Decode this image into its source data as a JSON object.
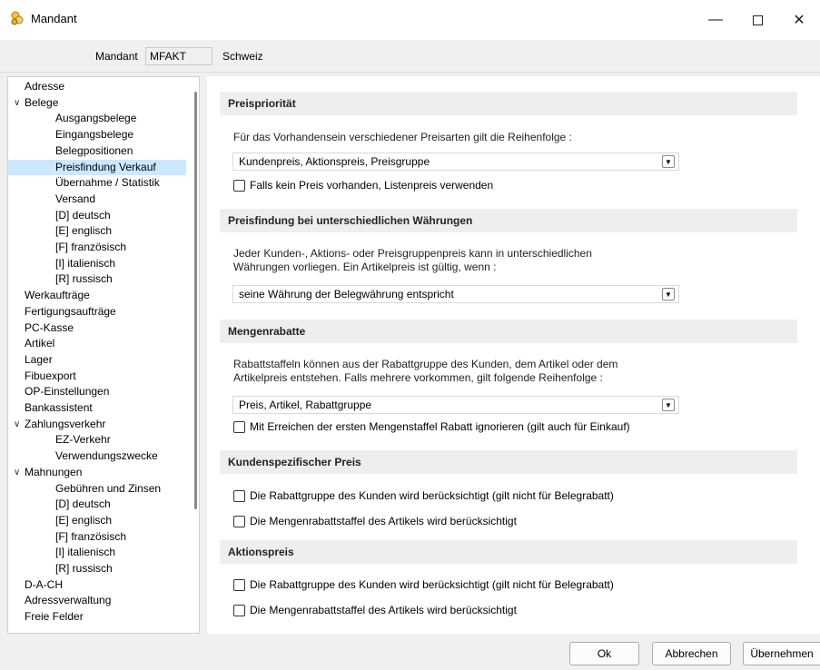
{
  "window": {
    "title": "Mandant",
    "minimize": "—",
    "close": "✕",
    "icon": "mandant-app-icon"
  },
  "header": {
    "mandant_label": "Mandant",
    "mandant_value": "MFAKT",
    "mandant_name": "Schweiz"
  },
  "tree": {
    "items": [
      {
        "label": "Adresse",
        "indent": 0,
        "arrow": ""
      },
      {
        "label": "Belege",
        "indent": 0,
        "arrow": "expanded"
      },
      {
        "label": "Ausgangsbelege",
        "indent": 2,
        "arrow": ""
      },
      {
        "label": "Eingangsbelege",
        "indent": 2,
        "arrow": ""
      },
      {
        "label": "Belegpositionen",
        "indent": 2,
        "arrow": ""
      },
      {
        "label": "Preisfindung Verkauf",
        "indent": 2,
        "arrow": "",
        "selected": true
      },
      {
        "label": "Übernahme / Statistik",
        "indent": 2,
        "arrow": ""
      },
      {
        "label": "Versand",
        "indent": 2,
        "arrow": ""
      },
      {
        "label": "[D] deutsch",
        "indent": 2,
        "arrow": ""
      },
      {
        "label": "[E] englisch",
        "indent": 2,
        "arrow": ""
      },
      {
        "label": "[F] französisch",
        "indent": 2,
        "arrow": ""
      },
      {
        "label": "[I] italienisch",
        "indent": 2,
        "arrow": ""
      },
      {
        "label": "[R] russisch",
        "indent": 2,
        "arrow": ""
      },
      {
        "label": "Werkaufträge",
        "indent": 0,
        "arrow": ""
      },
      {
        "label": "Fertigungsaufträge",
        "indent": 0,
        "arrow": ""
      },
      {
        "label": "PC-Kasse",
        "indent": 0,
        "arrow": ""
      },
      {
        "label": "Artikel",
        "indent": 0,
        "arrow": ""
      },
      {
        "label": "Lager",
        "indent": 0,
        "arrow": ""
      },
      {
        "label": "Fibuexport",
        "indent": 0,
        "arrow": ""
      },
      {
        "label": "OP-Einstellungen",
        "indent": 0,
        "arrow": ""
      },
      {
        "label": "Bankassistent",
        "indent": 0,
        "arrow": ""
      },
      {
        "label": "Zahlungsverkehr",
        "indent": 0,
        "arrow": "expanded"
      },
      {
        "label": "EZ-Verkehr",
        "indent": 2,
        "arrow": ""
      },
      {
        "label": "Verwendungszwecke",
        "indent": 2,
        "arrow": ""
      },
      {
        "label": "Mahnungen",
        "indent": 0,
        "arrow": "expanded"
      },
      {
        "label": "Gebühren und Zinsen",
        "indent": 2,
        "arrow": ""
      },
      {
        "label": "[D] deutsch",
        "indent": 2,
        "arrow": ""
      },
      {
        "label": "[E] englisch",
        "indent": 2,
        "arrow": ""
      },
      {
        "label": "[F] französisch",
        "indent": 2,
        "arrow": ""
      },
      {
        "label": "[I] italienisch",
        "indent": 2,
        "arrow": ""
      },
      {
        "label": "[R] russisch",
        "indent": 2,
        "arrow": ""
      },
      {
        "label": "D-A-CH",
        "indent": 0,
        "arrow": ""
      },
      {
        "label": "Adressverwaltung",
        "indent": 0,
        "arrow": ""
      },
      {
        "label": "Freie Felder",
        "indent": 0,
        "arrow": ""
      }
    ]
  },
  "sections": {
    "preisprio": {
      "title": "Preispriorität",
      "text": "Für das Vorhandensein verschiedener Preisarten gilt die Reihenfolge :",
      "dropdown": "Kundenpreis, Aktionspreis, Preisgruppe",
      "check": "Falls kein Preis vorhanden, Listenpreis verwenden"
    },
    "waehrung": {
      "title": "Preisfindung bei unterschiedlichen Währungen",
      "text1": "Jeder Kunden-, Aktions- oder Preisgruppenpreis kann in unterschiedlichen",
      "text2": "Währungen vorliegen. Ein Artikelpreis ist gültig, wenn :",
      "dropdown": "seine Währung der Belegwährung entspricht"
    },
    "mengen": {
      "title": "Mengenrabatte",
      "text1": "Rabattstaffeln können aus der Rabattgruppe des Kunden, dem Artikel oder dem",
      "text2": "Artikelpreis entstehen. Falls mehrere vorkommen, gilt folgende Reihenfolge :",
      "dropdown": "Preis, Artikel, Rabattgruppe",
      "check": "Mit Erreichen der ersten Mengenstaffel Rabatt ignorieren (gilt auch für Einkauf)"
    },
    "kunden": {
      "title": "Kundenspezifischer Preis",
      "check1": "Die Rabattgruppe des Kunden wird berücksichtigt (gilt nicht für Belegrabatt)",
      "check2": "Die Mengenrabattstaffel des Artikels wird berücksichtigt"
    },
    "aktion": {
      "title": "Aktionspreis",
      "check1": "Die Rabattgruppe des Kunden wird berücksichtigt (gilt nicht für Belegrabatt)",
      "check2": "Die Mengenrabattstaffel des Artikels wird berücksichtigt"
    }
  },
  "buttons": {
    "ok": "Ok",
    "cancel": "Abbrechen",
    "accept": "Übernehmen"
  }
}
